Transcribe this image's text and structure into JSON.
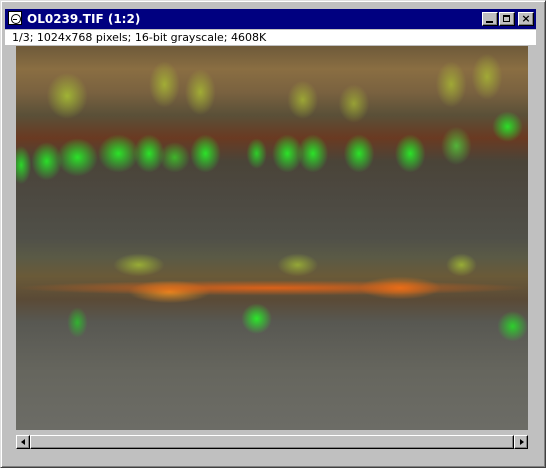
{
  "window": {
    "title": "OL0239.TIF (1:2)",
    "icon": "imagej-app-icon",
    "controls": {
      "minimize_icon": "minimize-icon",
      "maximize_icon": "maximize-icon",
      "close_icon": "close-icon",
      "close_glyph": "×"
    }
  },
  "info_bar": {
    "text": "1/3; 1024x768 pixels; 16-bit grayscale; 4608K"
  },
  "image": {
    "content": "fluorescence microscopy overlay: green nuclei, red/orange band over grayscale tissue",
    "colors": {
      "green_signal": "#28e628",
      "red_signal": "#f06414",
      "yellow_signal": "#aac832"
    }
  },
  "scrollbar": {
    "orientation": "horizontal",
    "left_arrow_icon": "arrow-left-icon",
    "right_arrow_icon": "arrow-right-icon",
    "thumb_fraction": 1.0
  },
  "colors": {
    "title_bar": "#000080",
    "window_face": "#c0c0c0",
    "info_bar_bg": "#ffffff"
  }
}
